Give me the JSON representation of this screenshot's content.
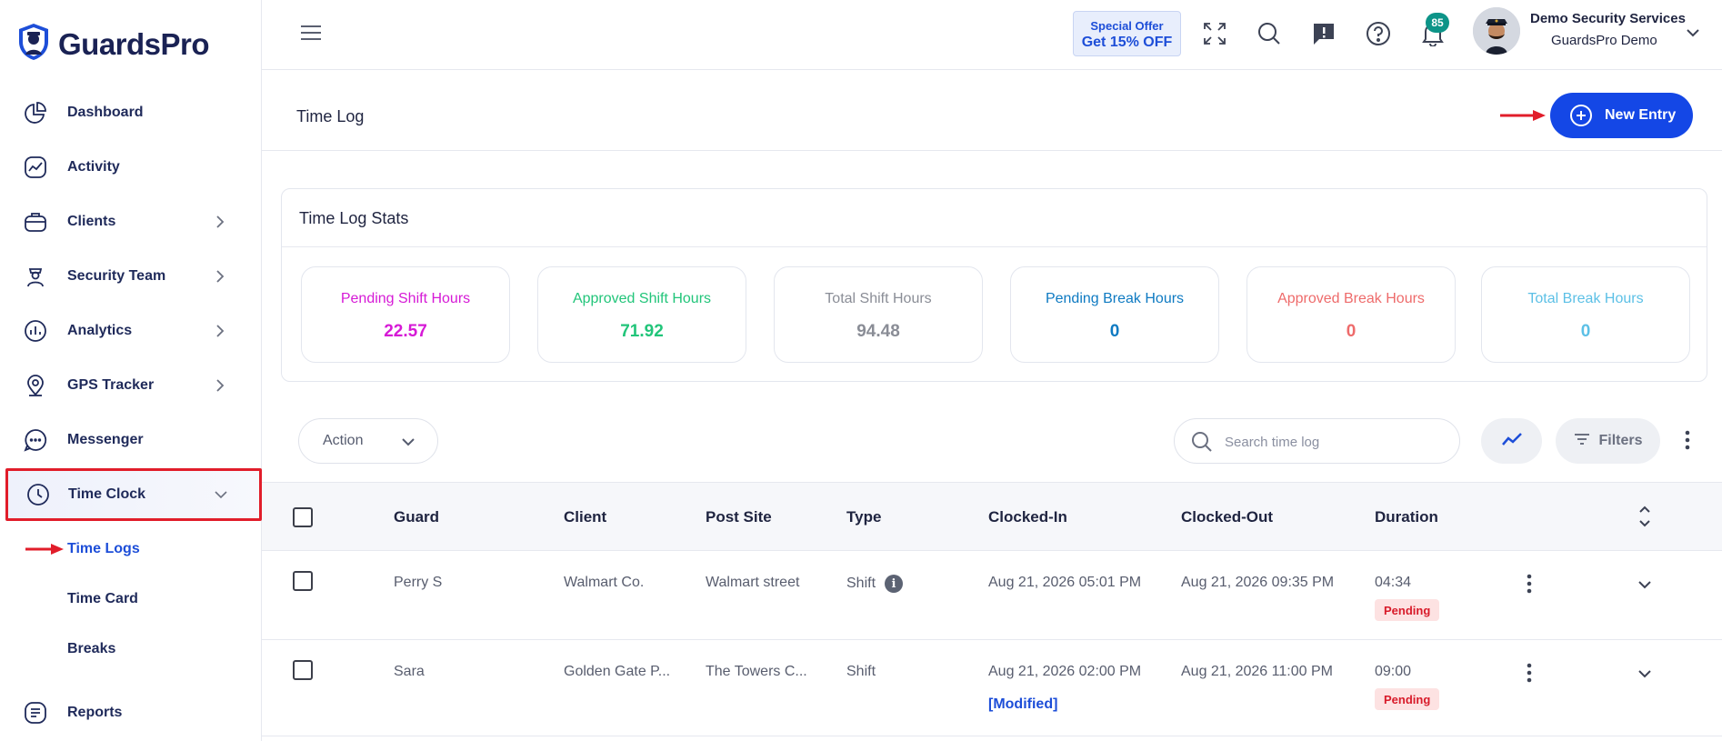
{
  "brand": {
    "name": "GuardsPro"
  },
  "sidebar": {
    "items": [
      {
        "label": "Dashboard",
        "icon": "pie-chart-icon"
      },
      {
        "label": "Activity",
        "icon": "activity-chart-icon"
      },
      {
        "label": "Clients",
        "icon": "briefcase-icon"
      },
      {
        "label": "Security Team",
        "icon": "guard-icon"
      },
      {
        "label": "Analytics",
        "icon": "bar-chart-icon"
      },
      {
        "label": "GPS Tracker",
        "icon": "location-pin-icon"
      },
      {
        "label": "Messenger",
        "icon": "chat-bubble-icon"
      },
      {
        "label": "Time Clock",
        "icon": "clock-icon"
      },
      {
        "label": "Reports",
        "icon": "document-icon"
      }
    ],
    "time_clock_sub": [
      "Time Logs",
      "Time Card",
      "Breaks"
    ]
  },
  "topbar": {
    "offer_line1": "Special Offer",
    "offer_line2": "Get 15% OFF",
    "notification_count": "85",
    "user_name": "Demo Security Services",
    "user_org": "GuardsPro Demo"
  },
  "page": {
    "title": "Time Log",
    "new_entry_label": "New Entry"
  },
  "stats": {
    "title": "Time Log Stats",
    "items": [
      {
        "label": "Pending Shift Hours",
        "value": "22.57",
        "color": "#d61ad6"
      },
      {
        "label": "Approved Shift Hours",
        "value": "71.92",
        "color": "#22c57a"
      },
      {
        "label": "Total Shift Hours",
        "value": "94.48",
        "color": "#8a8d96"
      },
      {
        "label": "Pending Break Hours",
        "value": "0",
        "color": "#0e7ac2"
      },
      {
        "label": "Approved Break Hours",
        "value": "0",
        "color": "#ee6b6b"
      },
      {
        "label": "Total Break Hours",
        "value": "0",
        "color": "#5cc0e6"
      }
    ]
  },
  "toolbar": {
    "action_label": "Action",
    "search_placeholder": "Search time log",
    "filters_label": "Filters"
  },
  "table": {
    "columns": [
      "Guard",
      "Client",
      "Post Site",
      "Type",
      "Clocked-In",
      "Clocked-Out",
      "Duration"
    ],
    "rows": [
      {
        "guard": "Perry S",
        "client": "Walmart Co.",
        "post_site": "Walmart street",
        "type": "Shift",
        "clocked_in": "Aug 21, 2026 05:01 PM",
        "clocked_out": "Aug 21, 2026 09:35 PM",
        "duration": "04:34",
        "status": "Pending",
        "info_glyph": "i"
      },
      {
        "guard": "Sara",
        "client": "Golden Gate P...",
        "post_site": "The Towers C...",
        "type": "Shift",
        "clocked_in": "Aug 21, 2026 02:00 PM",
        "modified_label": "[Modified]",
        "clocked_out": "Aug 21, 2026 11:00 PM",
        "duration": "09:00",
        "status": "Pending"
      }
    ]
  },
  "colors": {
    "primary": "#1447e6",
    "nav_text": "#1f2a5a",
    "highlight_border": "#e11d2a",
    "badge_bg": "#0d9488"
  }
}
